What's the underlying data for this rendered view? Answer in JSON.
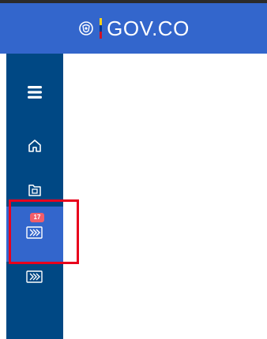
{
  "header": {
    "brand": "GOV.CO",
    "shield_icon": "colombia-shield-icon",
    "flag_colors": [
      "#fcd116",
      "#003893",
      "#ce1126"
    ],
    "background": "#3366cc"
  },
  "sidebar": {
    "background": "#004884",
    "items": [
      {
        "icon": "hamburger-menu-icon"
      },
      {
        "icon": "home-icon"
      },
      {
        "icon": "folder-icon"
      },
      {
        "icon": "chevrons-forward-icon",
        "badge": "17",
        "active": true
      },
      {
        "icon": "chevrons-forward-icon"
      }
    ]
  },
  "annotation": {
    "highlight_color": "#e8001c"
  }
}
